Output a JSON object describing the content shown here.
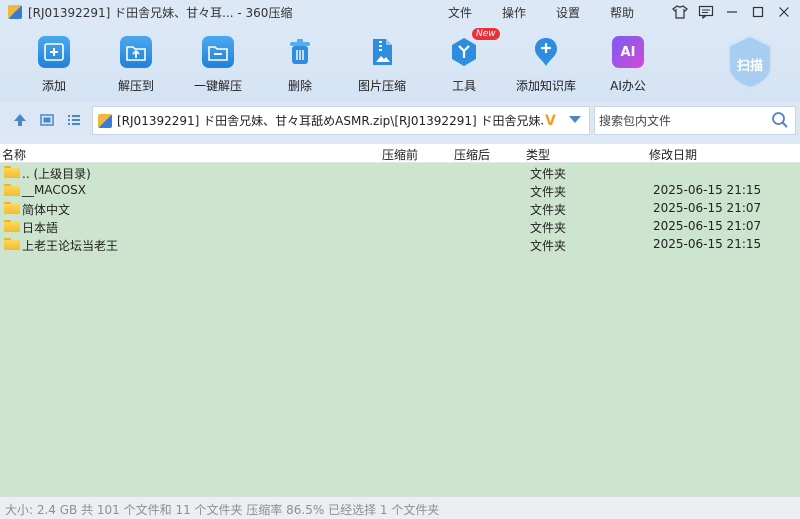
{
  "window": {
    "title": "[RJ01392291] ド田舎兄妹、甘々耳... - 360压缩",
    "menus": [
      "文件",
      "操作",
      "设置",
      "帮助"
    ]
  },
  "toolbar": {
    "tools": [
      {
        "label": "添加",
        "icon": "add-file-icon"
      },
      {
        "label": "解压到",
        "icon": "extract-to-icon"
      },
      {
        "label": "一键解压",
        "icon": "one-click-extract-icon"
      },
      {
        "label": "删除",
        "icon": "trash-icon"
      },
      {
        "label": "图片压缩",
        "icon": "image-compress-icon"
      },
      {
        "label": "工具",
        "icon": "tools-icon",
        "badge": "New"
      },
      {
        "label": "添加知识库",
        "icon": "knowledge-base-icon"
      },
      {
        "label": "AI办公",
        "icon": "ai-office-icon",
        "icon_text": "AI"
      }
    ],
    "scan_label": "扫描"
  },
  "address": {
    "path": "[RJ01392291] ド田舎兄妹、甘々耳舐めASMR.zip\\[RJ01392291] ド田舎兄妹、甘々",
    "path_suffix": "V",
    "search_placeholder": "搜索包内文件"
  },
  "columns": [
    "名称",
    "压缩前",
    "压缩后",
    "类型",
    "修改日期"
  ],
  "rows": [
    {
      "name": ".. (上级目录)",
      "type": "文件夹",
      "date": ""
    },
    {
      "name": "__MACOSX",
      "type": "文件夹",
      "date": "2025-06-15 21:15"
    },
    {
      "name": "简体中文",
      "type": "文件夹",
      "date": "2025-06-15 21:07"
    },
    {
      "name": "日本語",
      "type": "文件夹",
      "date": "2025-06-15 21:07"
    },
    {
      "name": "上老王论坛当老王",
      "type": "文件夹",
      "date": "2025-06-15 21:15"
    }
  ],
  "status": "大小: 2.4 GB 共 101 个文件和 11 个文件夹 压缩率 86.5% 已经选择 1 个文件夹",
  "colors": {
    "accent": "#2181d8",
    "list_bg": "#cde5cf",
    "badge": "#e8323a"
  }
}
